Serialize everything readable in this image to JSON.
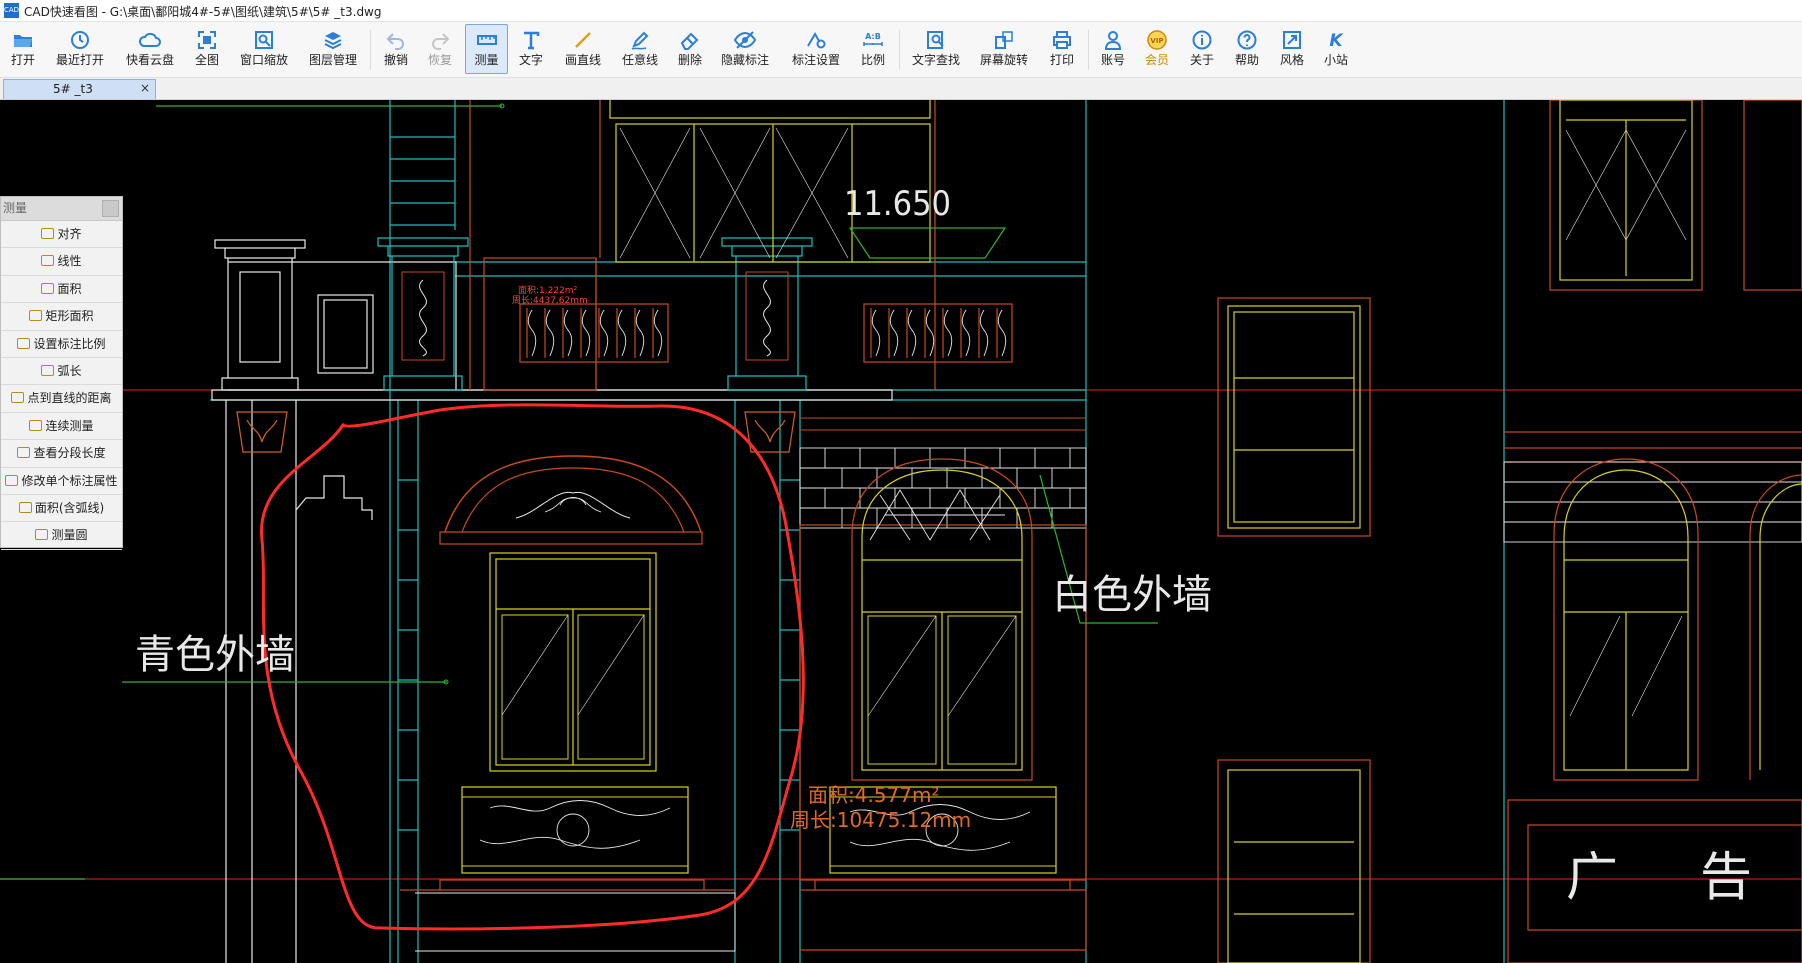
{
  "window": {
    "title": "CAD快速看图 - G:\\桌面\\鄱阳城4#-5#\\图纸\\建筑\\5#\\5# _t3.dwg",
    "app_icon_text": "CAD"
  },
  "toolbar": {
    "open": "打开",
    "recent": "最近打开",
    "cloud": "快看云盘",
    "full": "全图",
    "zoom_window": "窗口缩放",
    "layers": "图层管理",
    "undo": "撤销",
    "redo": "恢复",
    "measure": "测量",
    "text": "文字",
    "line": "画直线",
    "freehand": "任意线",
    "delete": "删除",
    "hide_dim": "隐藏标注",
    "dim_settings": "标注设置",
    "scale": "比例",
    "scale_icon": "A:B",
    "find_text": "文字查找",
    "rotate": "屏幕旋转",
    "print": "打印",
    "account": "账号",
    "vip": "会员",
    "vip_icon": "VIP",
    "about": "关于",
    "help": "帮助",
    "style": "风格",
    "site": "小站",
    "site_icon": "K"
  },
  "tabs": {
    "active_label": "5# _t3",
    "close": "×"
  },
  "measure_panel": {
    "title": "测量",
    "items": [
      "对齐",
      "线性",
      "面积",
      "矩形面积",
      "设置标注比例",
      "弧长",
      "点到直线的距离",
      "连续测量",
      "查看分段长度",
      "修改单个标注属性",
      "面积(含弧线)",
      "测量圆"
    ]
  },
  "drawing": {
    "elevation": "11.650",
    "label_left": "青色外墙",
    "label_right": "白色外墙",
    "area_small": "面积:1.222m²",
    "perim_small": "周长:4437.62mm",
    "area_main": "面积:4.577m²",
    "perim_main": "周长:10475.12mm",
    "sign_a": "广",
    "sign_b": "告"
  },
  "colors": {
    "cad_background": "#000000",
    "cyan": "#1fbdbd",
    "yellow": "#d8d31f",
    "orange": "#d0621f",
    "red": "#ff2a2a",
    "green": "#2fb52f",
    "white": "#e8e8e8",
    "active_tab": "#cfe0f6",
    "vip": "#d08a00"
  }
}
